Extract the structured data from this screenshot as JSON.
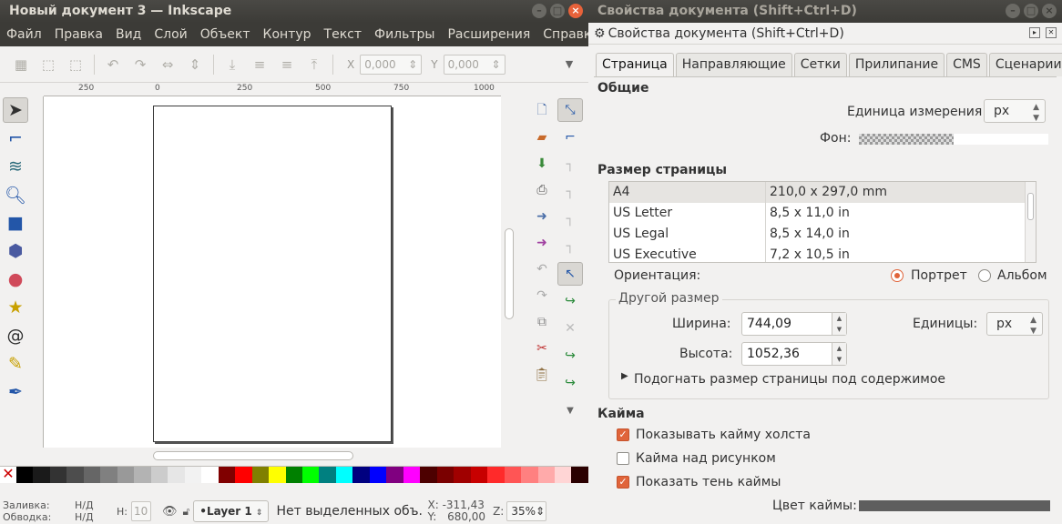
{
  "main_window": {
    "title": "Новый документ 3 — Inkscape",
    "menu": [
      "Файл",
      "Правка",
      "Вид",
      "Слой",
      "Объект",
      "Контур",
      "Текст",
      "Фильтры",
      "Расширения",
      "Справка"
    ],
    "toolbar": {
      "x_label": "X",
      "x_value": "0,000",
      "y_label": "Y",
      "y_value": "0,000"
    },
    "ruler_marks": [
      "250",
      "0",
      "250",
      "500",
      "750",
      "1000"
    ],
    "palette": [
      "#000000",
      "#1a1a1a",
      "#333333",
      "#4d4d4d",
      "#666666",
      "#808080",
      "#999999",
      "#b3b3b3",
      "#cccccc",
      "#e6e6e6",
      "#f2f2f2",
      "#ffffff",
      "#800000",
      "#ff0000",
      "#808000",
      "#ffff00",
      "#008000",
      "#00ff00",
      "#008080",
      "#00ffff",
      "#000080",
      "#0000ff",
      "#800080",
      "#ff00ff",
      "#4d0000",
      "#7a0000",
      "#a00000",
      "#c80000",
      "#ff2a2a",
      "#ff5555",
      "#ff8080",
      "#ffaaaa",
      "#ffd5d5",
      "#2b0000"
    ],
    "status": {
      "fill_label": "Заливка:",
      "fill_value": "Н/Д",
      "stroke_label": "Обводка:",
      "stroke_value": "Н/Д",
      "h_label": "H:",
      "h_value": "10",
      "layer": "•Layer 1",
      "message": "Нет выделенных объ...",
      "x_label": "X:",
      "x_value": "-311,43",
      "y_label": "Y:",
      "y_value": "680,00",
      "zoom_label": "Z:",
      "zoom_value": "35%"
    }
  },
  "props_window": {
    "title": "Свойства документа (Shift+Ctrl+D)",
    "dock_title": "Свойства документа (Shift+Ctrl+D)",
    "tabs": [
      "Страница",
      "Направляющие",
      "Сетки",
      "Прилипание",
      "CMS",
      "Сценарии"
    ],
    "general": {
      "heading": "Общие",
      "unit_label": "Единица измерения:",
      "unit_value": "px",
      "background_label": "Фон:"
    },
    "page_size": {
      "heading": "Размер страницы",
      "rows": [
        {
          "name": "A4",
          "size": "210,0 x 297,0 mm"
        },
        {
          "name": "US Letter",
          "size": "8,5 x 11,0 in"
        },
        {
          "name": "US Legal",
          "size": "8,5 x 14,0 in"
        },
        {
          "name": "US Executive",
          "size": "7,2 x 10,5 in"
        }
      ],
      "orientation_label": "Ориентация:",
      "portrait": "Портрет",
      "landscape": "Альбом"
    },
    "custom_size": {
      "legend": "Другой размер",
      "width_label": "Ширина:",
      "width_value": "744,09",
      "height_label": "Высота:",
      "height_value": "1052,36",
      "units_label": "Единицы:",
      "units_value": "px",
      "fit_label": "Подогнать размер страницы под содержимое"
    },
    "border": {
      "heading": "Кайма",
      "show_canvas_border": "Показывать кайму холста",
      "border_on_top": "Кайма над рисунком",
      "show_border_shadow": "Показать тень каймы",
      "border_color_label": "Цвет каймы:"
    }
  }
}
